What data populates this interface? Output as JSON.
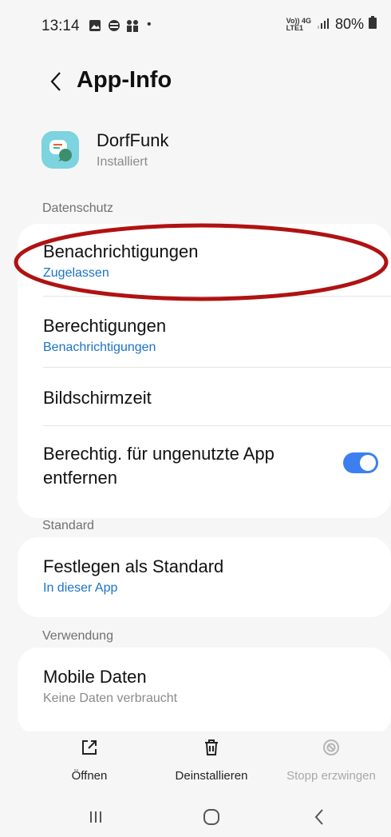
{
  "status_bar": {
    "time": "13:14",
    "battery": "80%",
    "network_top": "Vo)) 4G",
    "network_bottom": "LTE1"
  },
  "header": {
    "title": "App-Info"
  },
  "app": {
    "name": "DorfFunk",
    "status": "Installiert"
  },
  "sections": {
    "datenschutz": "Datenschutz",
    "standard": "Standard",
    "verwendung": "Verwendung"
  },
  "rows": {
    "notifications": {
      "title": "Benachrichtigungen",
      "sub": "Zugelassen"
    },
    "permissions": {
      "title": "Berechtigungen",
      "sub": "Benachrichtigungen"
    },
    "screentime": {
      "title": "Bildschirmzeit"
    },
    "unused": {
      "title_line1": "Berechtig. für ungenutzte App",
      "title_line2": "entfernen",
      "toggle_on": true
    },
    "default": {
      "title": "Festlegen als Standard",
      "sub": "In dieser App"
    },
    "mobile_data": {
      "title": "Mobile Daten",
      "sub": "Keine Daten verbraucht"
    }
  },
  "bottom_actions": {
    "open": "Öffnen",
    "uninstall": "Deinstallieren",
    "force_stop": "Stopp erzwingen"
  },
  "colors": {
    "accent": "#3c7ff0",
    "link": "#1a73c8",
    "annotation": "#b01212",
    "app_icon": "#7dd3df"
  }
}
